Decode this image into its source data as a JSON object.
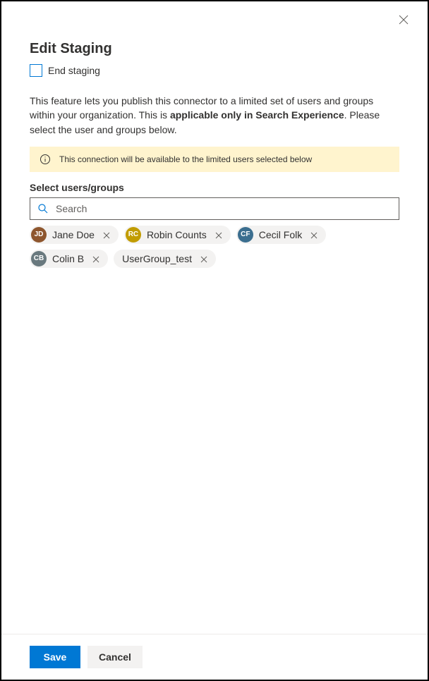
{
  "header": {
    "title": "Edit Staging",
    "checkbox_label": "End staging"
  },
  "description": {
    "part1": "This feature lets you publish this connector to a limited set of users and groups within your organization. This is ",
    "bold": "applicable only in Search Experience",
    "part2": ". Please select the user and groups below."
  },
  "banner": {
    "text": "This connection will be available to the limited users selected below"
  },
  "select": {
    "label": "Select users/groups",
    "search_placeholder": "Search"
  },
  "chips": [
    {
      "label": "Jane Doe",
      "has_avatar": true,
      "avatar_bg": "#8e562e",
      "initials": "JD"
    },
    {
      "label": "Robin Counts",
      "has_avatar": true,
      "avatar_bg": "#c19c00",
      "initials": "RC"
    },
    {
      "label": "Cecil Folk",
      "has_avatar": true,
      "avatar_bg": "#3b6e8f",
      "initials": "CF"
    },
    {
      "label": "Colin B",
      "has_avatar": true,
      "avatar_bg": "#69797e",
      "initials": "CB"
    },
    {
      "label": "UserGroup_test",
      "has_avatar": false
    }
  ],
  "footer": {
    "save": "Save",
    "cancel": "Cancel"
  }
}
